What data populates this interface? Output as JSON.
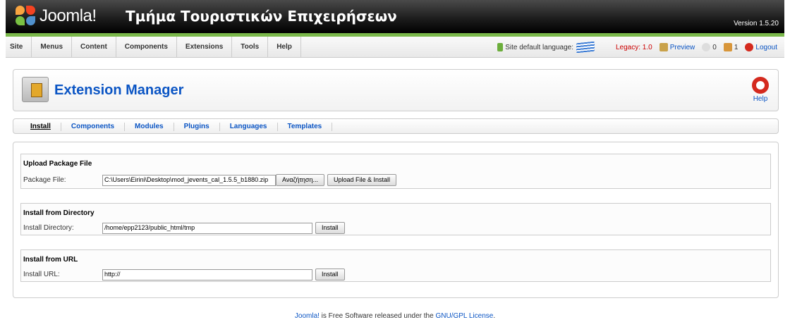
{
  "header": {
    "logo_text": "Joomla!",
    "site_title": "Τμήμα Τουριστικών Επιχειρήσεων",
    "version": "Version 1.5.20"
  },
  "menu": {
    "items": [
      {
        "label": "Site"
      },
      {
        "label": "Menus"
      },
      {
        "label": "Content"
      },
      {
        "label": "Components"
      },
      {
        "label": "Extensions"
      },
      {
        "label": "Tools"
      },
      {
        "label": "Help"
      }
    ]
  },
  "status": {
    "language_label": "Site default language:",
    "legacy": "Legacy: 1.0",
    "preview": "Preview",
    "messages_count": "0",
    "users_count": "1",
    "logout": "Logout"
  },
  "toolbar": {
    "title": "Extension Manager",
    "help_label": "Help"
  },
  "submenu": {
    "items": [
      {
        "label": "Install"
      },
      {
        "label": "Components"
      },
      {
        "label": "Modules"
      },
      {
        "label": "Plugins"
      },
      {
        "label": "Languages"
      },
      {
        "label": "Templates"
      }
    ]
  },
  "upload": {
    "legend": "Upload Package File",
    "label": "Package File:",
    "value": "C:\\Users\\Eirini\\Desktop\\mod_jevents_cal_1.5.5_b1880.zip",
    "browse_label": "Αναζήτηση...",
    "submit_label": "Upload File & Install"
  },
  "directory": {
    "legend": "Install from Directory",
    "label": "Install Directory:",
    "value": "/home/epp2123/public_html/tmp",
    "submit_label": "Install"
  },
  "url": {
    "legend": "Install from URL",
    "label": "Install URL:",
    "value": "http://",
    "submit_label": "Install"
  },
  "footer": {
    "brand": "Joomla!",
    "text": " is Free Software released under the ",
    "license": "GNU/GPL License",
    "end": "."
  },
  "colors": {
    "accent": "#0b55c4",
    "header_green": "#7ab84a",
    "legacy_red": "#cc0000"
  }
}
